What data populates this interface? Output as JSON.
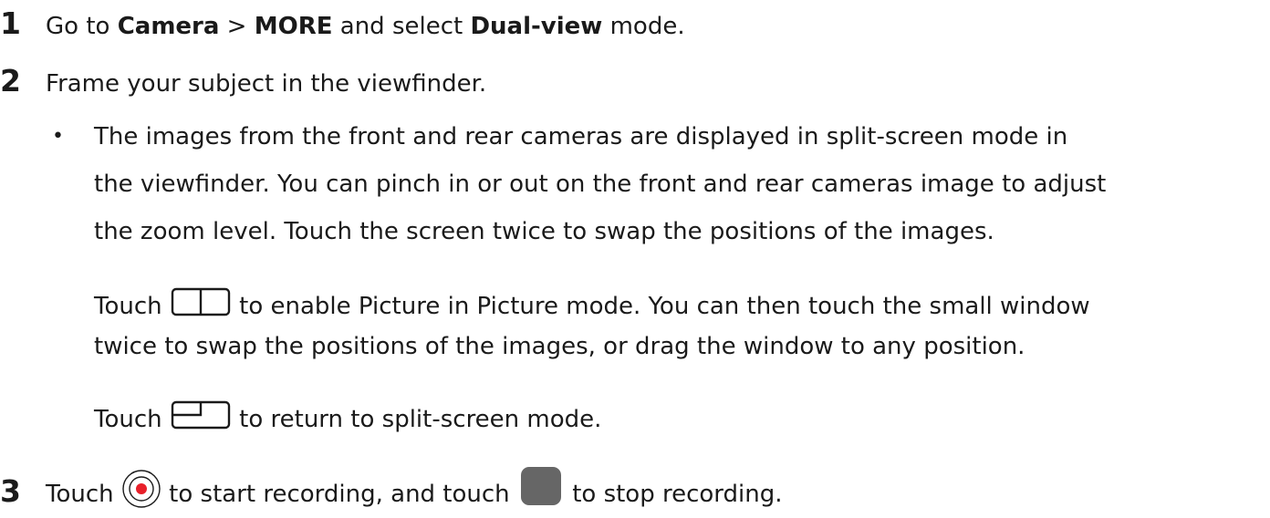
{
  "steps": [
    {
      "number": "1",
      "prefix": "Go to ",
      "bold1": "Camera",
      "sep": " > ",
      "bold2": "MORE",
      "middle": " and select ",
      "bold3": "Dual-view",
      "suffix": " mode."
    },
    {
      "number": "2",
      "text": "Frame your subject in the viewfinder."
    },
    {
      "number": "3",
      "part1": "Touch",
      "part2": " to start recording, and touch",
      "part3": " to stop recording."
    }
  ],
  "bullet": {
    "symbol": "•",
    "line1": "The images from the front and rear cameras are displayed in split-screen mode in",
    "line2": "the viewfinder. You can pinch in or out on the front and rear cameras image to adjust",
    "line3": "the zoom level. Touch the screen twice to swap the positions of the images."
  },
  "pip": {
    "touch": "Touch",
    "line1_rest": " to enable Picture in Picture mode. You can then touch the small window",
    "line2": "twice to swap the positions of the images, or drag the window to any position."
  },
  "split": {
    "touch": "Touch",
    "rest": " to return to split-screen mode."
  },
  "icons": {
    "split_screen": "split-screen-icon",
    "pip": "picture-in-picture-icon",
    "record": "record-icon",
    "stop": "stop-icon",
    "record_color": "#e8202a",
    "stop_color": "#666666"
  }
}
